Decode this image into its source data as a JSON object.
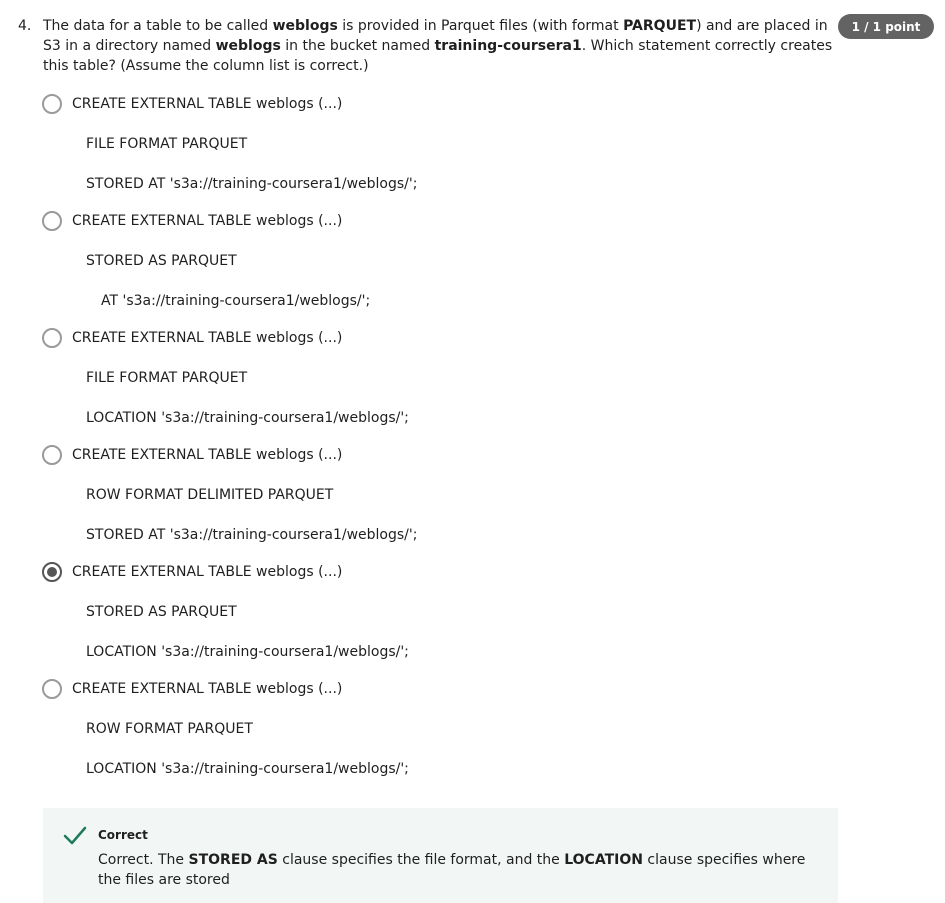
{
  "question": {
    "number": "4.",
    "parts": [
      {
        "t": "The data for a table to be called ",
        "b": false
      },
      {
        "t": "weblogs",
        "b": true
      },
      {
        "t": " is provided in Parquet files (with format ",
        "b": false
      },
      {
        "t": "PARQUET",
        "b": true
      },
      {
        "t": ") and are placed in S3 in a directory named ",
        "b": false
      },
      {
        "t": "weblogs",
        "b": true
      },
      {
        "t": " in the bucket named ",
        "b": false
      },
      {
        "t": "training-coursera1",
        "b": true
      },
      {
        "t": ". Which statement correctly creates this table? (Assume the column list is correct.)",
        "b": false
      }
    ],
    "score": "1 / 1 point"
  },
  "options": [
    {
      "selected": false,
      "lines": [
        "CREATE EXTERNAL TABLE weblogs (...)",
        "FILE FORMAT PARQUET",
        "STORED AT 's3a://training-coursera1/weblogs/';"
      ]
    },
    {
      "selected": false,
      "lines": [
        "CREATE EXTERNAL TABLE weblogs (...)",
        "STORED AS PARQUET",
        "AT 's3a://training-coursera1/weblogs/';"
      ]
    },
    {
      "selected": false,
      "lines": [
        "CREATE EXTERNAL TABLE weblogs (...)",
        "FILE FORMAT PARQUET",
        "LOCATION 's3a://training-coursera1/weblogs/';"
      ]
    },
    {
      "selected": false,
      "lines": [
        "CREATE EXTERNAL TABLE weblogs (...)",
        "ROW FORMAT DELIMITED PARQUET",
        "STORED AT 's3a://training-coursera1/weblogs/';"
      ]
    },
    {
      "selected": true,
      "lines": [
        "CREATE EXTERNAL TABLE weblogs (...)",
        "STORED AS PARQUET",
        "LOCATION 's3a://training-coursera1/weblogs/';"
      ]
    },
    {
      "selected": false,
      "lines": [
        "CREATE EXTERNAL TABLE weblogs (...)",
        "ROW FORMAT PARQUET",
        "LOCATION 's3a://training-coursera1/weblogs/';"
      ]
    }
  ],
  "feedback": {
    "title": "Correct",
    "parts": [
      {
        "t": "Correct. The ",
        "b": false
      },
      {
        "t": "STORED AS",
        "b": true
      },
      {
        "t": " clause specifies the file format, and the ",
        "b": false
      },
      {
        "t": "LOCATION",
        "b": true
      },
      {
        "t": " clause specifies where the files are stored",
        "b": false
      }
    ],
    "accent_color": "#1f7a5a"
  }
}
